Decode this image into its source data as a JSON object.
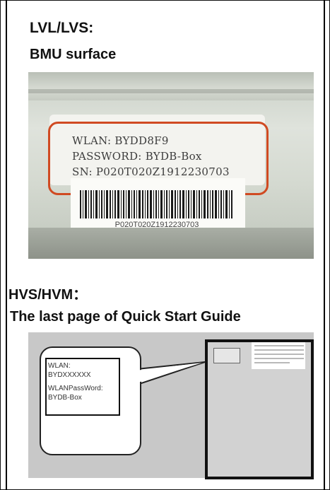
{
  "section1": {
    "heading": "LVL/LVS:",
    "subheading": "BMU surface",
    "label": {
      "wlan": "WLAN: BYDD8F9",
      "password": "PASSWORD: BYDB-Box",
      "sn": "SN: P020T020Z1912230703"
    },
    "barcode_text": "P020T020Z1912230703",
    "highlight_color": "#d04a22"
  },
  "section2": {
    "heading": "HVS/HVM：",
    "subheading": "The last page of Quick Start Guide",
    "callout": {
      "line1": "WLAN:",
      "line2": "BYDXXXXXX",
      "line3": "WLANPassWord:",
      "line4": "BYDB-Box"
    }
  }
}
